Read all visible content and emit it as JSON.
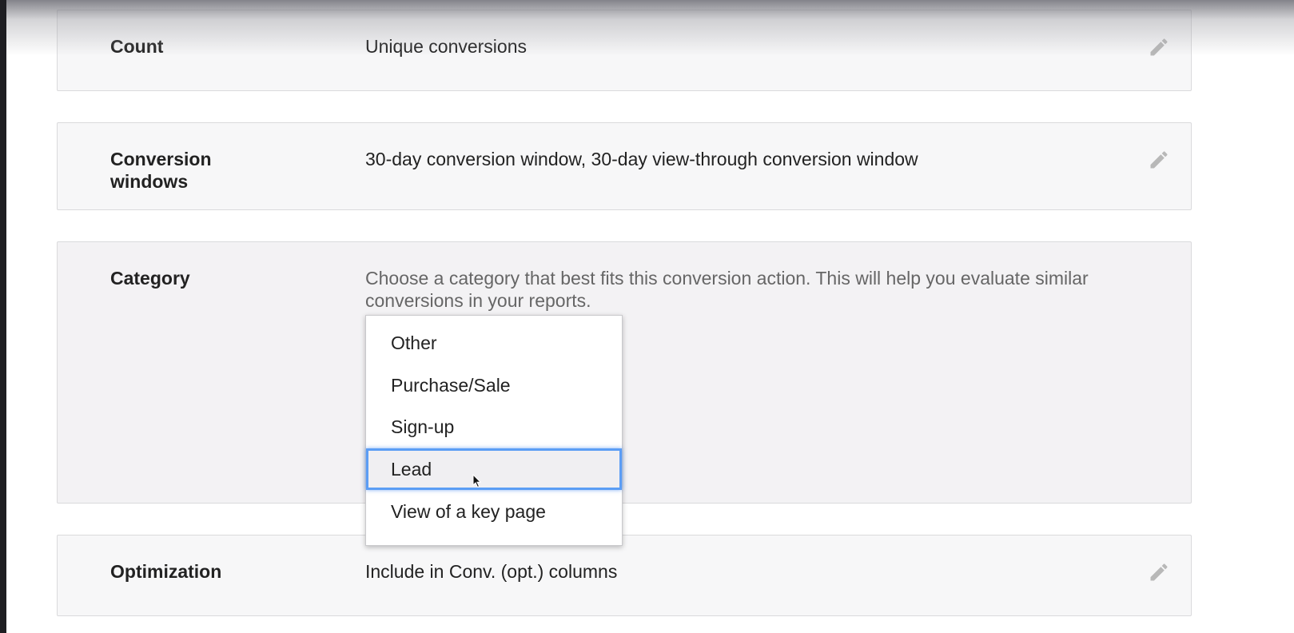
{
  "rows": {
    "count": {
      "label": "Count",
      "value": "Unique conversions"
    },
    "conversion_windows": {
      "label": "Conversion windows",
      "value": "30-day conversion window, 30-day view-through conversion window"
    },
    "category": {
      "label": "Category",
      "description": "Choose a category that best fits this conversion action. This will help you evaluate similar conversions in your reports."
    },
    "optimization": {
      "label": "Optimization",
      "value": "Include in Conv. (opt.) columns"
    }
  },
  "category_dropdown": {
    "options": [
      "Other",
      "Purchase/Sale",
      "Sign-up",
      "Lead",
      "View of a key page"
    ],
    "highlighted": "Lead"
  },
  "icons": {
    "edit": "pencil-icon",
    "cursor": "mouse-pointer-icon"
  },
  "colors": {
    "card_bg": "#f7f7f8",
    "card_border": "#dadadc",
    "highlight_border": "#5b9df5",
    "text": "#222222",
    "description_text": "#666666",
    "icon": "#b8b8b8"
  }
}
